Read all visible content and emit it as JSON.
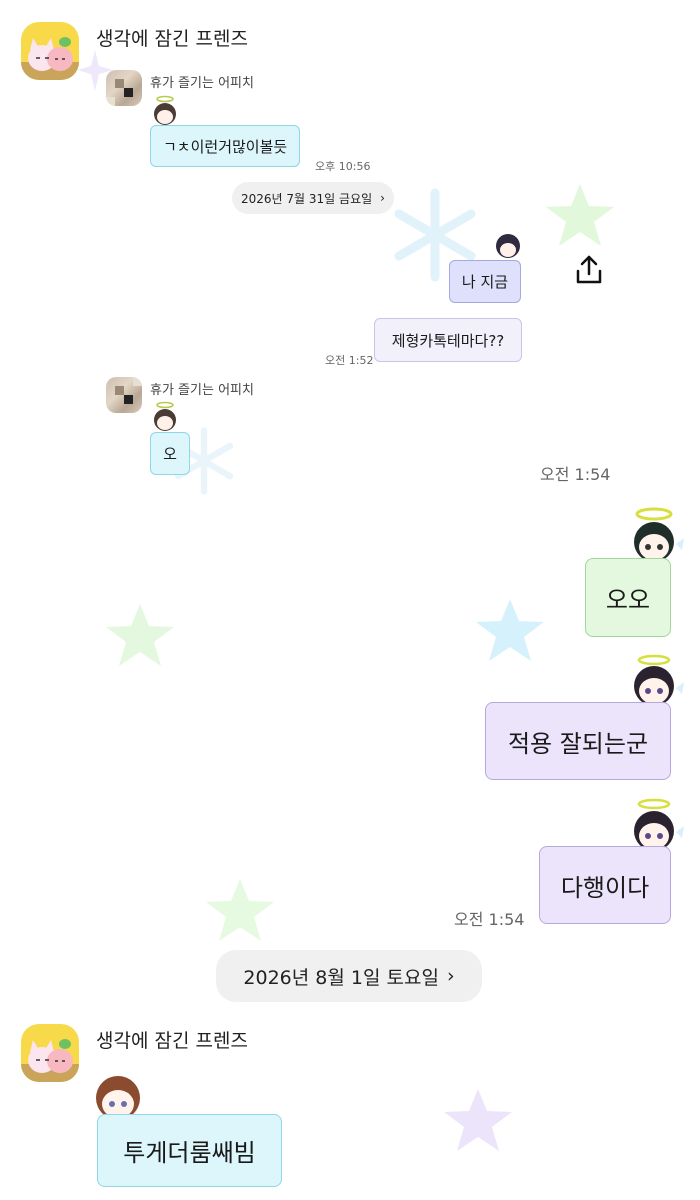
{
  "chat": {
    "group_name": "생각에 잠긴 프렌즈",
    "group_name_bottom": "생각에 잠긴 프렌즈"
  },
  "embedded": {
    "sender_name_1": "휴가 즐기는 어피치",
    "sender_name_2": "휴가 즐기는 어피치",
    "msg_1": "ㄱㅊ이런거많이볼듯",
    "time_1": "오후 10:56",
    "date_pill": "2026년 7월 31일 금요일",
    "msg_me_1": "나 지금",
    "msg_me_2": "제형카톡테마다??",
    "time_2": "오전 1:52",
    "msg_2": "오"
  },
  "main": {
    "time_1": "오전 1:54",
    "msg_me_1": "오오",
    "msg_me_2": "적용 잘되는군",
    "msg_me_3": "다행이다",
    "time_2": "오전 1:54",
    "date_pill": "2026년 8월 1일 토요일",
    "msg_friend": "투게더룸쌔빔"
  },
  "icons": {
    "share": "share-icon",
    "chevron": "chevron-right-icon"
  },
  "colors": {
    "cyan_bubble": "#dcf6fb",
    "lavender_bubble": "#ebe4fb",
    "green_bubble": "#e3f8df",
    "app_avatar_bg": "#f7d94a"
  }
}
